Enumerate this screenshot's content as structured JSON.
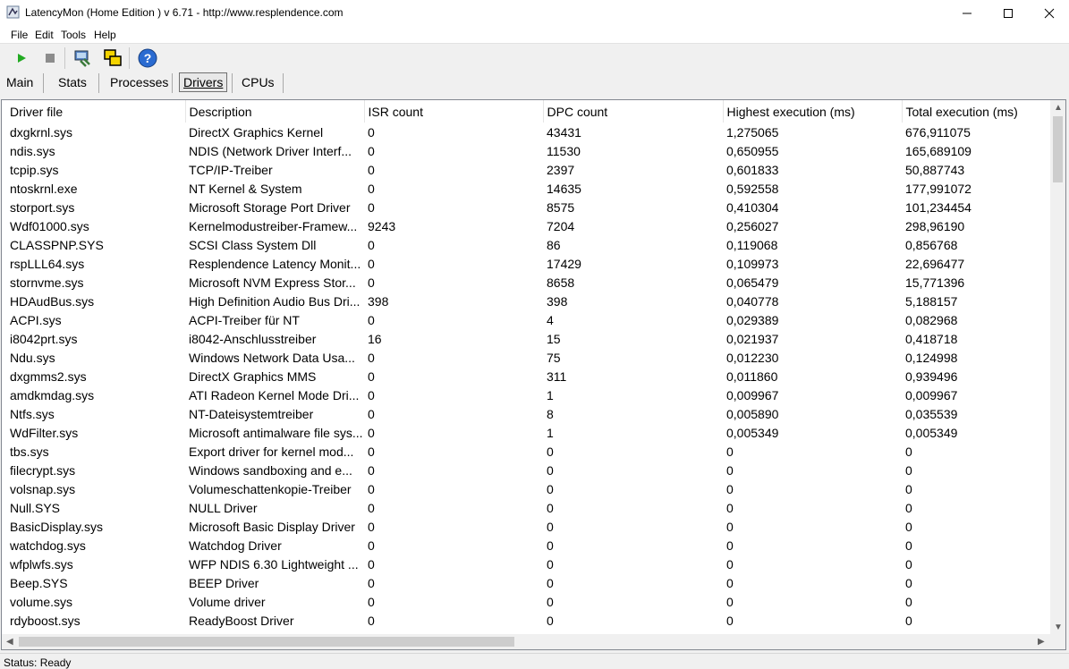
{
  "window": {
    "title": "LatencyMon  (Home Edition )  v 6.71 - http://www.resplendence.com"
  },
  "menu": {
    "file": "File",
    "edit": "Edit",
    "tools": "Tools",
    "help": "Help"
  },
  "toolbar": {
    "icons": [
      "play-icon",
      "stop-icon",
      "process-icon",
      "windows-icon",
      "help-icon"
    ]
  },
  "tabs": [
    "Main",
    "Stats",
    "Processes",
    "Drivers",
    "CPUs"
  ],
  "active_tab": "Drivers",
  "table": {
    "columns": [
      "Driver file",
      "Description",
      "ISR count",
      "DPC count",
      "Highest execution (ms)",
      "Total execution (ms)"
    ],
    "rows": [
      [
        "dxgkrnl.sys",
        "DirectX Graphics Kernel",
        "0",
        "43431",
        "1,275065",
        "676,911075"
      ],
      [
        "ndis.sys",
        "NDIS (Network Driver Interf...",
        "0",
        "11530",
        "0,650955",
        "165,689109"
      ],
      [
        "tcpip.sys",
        "TCP/IP-Treiber",
        "0",
        "2397",
        "0,601833",
        "50,887743"
      ],
      [
        "ntoskrnl.exe",
        "NT Kernel & System",
        "0",
        "14635",
        "0,592558",
        "177,991072"
      ],
      [
        "storport.sys",
        "Microsoft Storage Port Driver",
        "0",
        "8575",
        "0,410304",
        "101,234454"
      ],
      [
        "Wdf01000.sys",
        "Kernelmodustreiber-Framew...",
        "9243",
        "7204",
        "0,256027",
        "298,96190"
      ],
      [
        "CLASSPNP.SYS",
        "SCSI Class System Dll",
        "0",
        "86",
        "0,119068",
        "0,856768"
      ],
      [
        "rspLLL64.sys",
        "Resplendence Latency Monit...",
        "0",
        "17429",
        "0,109973",
        "22,696477"
      ],
      [
        "stornvme.sys",
        "Microsoft NVM Express Stor...",
        "0",
        "8658",
        "0,065479",
        "15,771396"
      ],
      [
        "HDAudBus.sys",
        "High Definition Audio Bus Dri...",
        "398",
        "398",
        "0,040778",
        "5,188157"
      ],
      [
        "ACPI.sys",
        "ACPI-Treiber für NT",
        "0",
        "4",
        "0,029389",
        "0,082968"
      ],
      [
        "i8042prt.sys",
        "i8042-Anschlusstreiber",
        "16",
        "15",
        "0,021937",
        "0,418718"
      ],
      [
        "Ndu.sys",
        "Windows Network Data Usa...",
        "0",
        "75",
        "0,012230",
        "0,124998"
      ],
      [
        "dxgmms2.sys",
        "DirectX Graphics MMS",
        "0",
        "311",
        "0,011860",
        "0,939496"
      ],
      [
        "amdkmdag.sys",
        "ATI Radeon Kernel Mode Dri...",
        "0",
        "1",
        "0,009967",
        "0,009967"
      ],
      [
        "Ntfs.sys",
        "NT-Dateisystemtreiber",
        "0",
        "8",
        "0,005890",
        "0,035539"
      ],
      [
        "WdFilter.sys",
        "Microsoft antimalware file sys...",
        "0",
        "1",
        "0,005349",
        "0,005349"
      ],
      [
        "tbs.sys",
        "Export driver for kernel mod...",
        "0",
        "0",
        "0",
        "0"
      ],
      [
        "filecrypt.sys",
        "Windows sandboxing and e...",
        "0",
        "0",
        "0",
        "0"
      ],
      [
        "volsnap.sys",
        "Volumeschattenkopie-Treiber",
        "0",
        "0",
        "0",
        "0"
      ],
      [
        "Null.SYS",
        "NULL Driver",
        "0",
        "0",
        "0",
        "0"
      ],
      [
        "BasicDisplay.sys",
        "Microsoft Basic Display Driver",
        "0",
        "0",
        "0",
        "0"
      ],
      [
        "watchdog.sys",
        "Watchdog Driver",
        "0",
        "0",
        "0",
        "0"
      ],
      [
        "wfplwfs.sys",
        "WFP NDIS 6.30 Lightweight ...",
        "0",
        "0",
        "0",
        "0"
      ],
      [
        "Beep.SYS",
        "BEEP Driver",
        "0",
        "0",
        "0",
        "0"
      ],
      [
        "volume.sys",
        "Volume driver",
        "0",
        "0",
        "0",
        "0"
      ],
      [
        "rdyboost.sys",
        "ReadyBoost Driver",
        "0",
        "0",
        "0",
        "0"
      ]
    ]
  },
  "status": {
    "text": "Status: Ready"
  }
}
